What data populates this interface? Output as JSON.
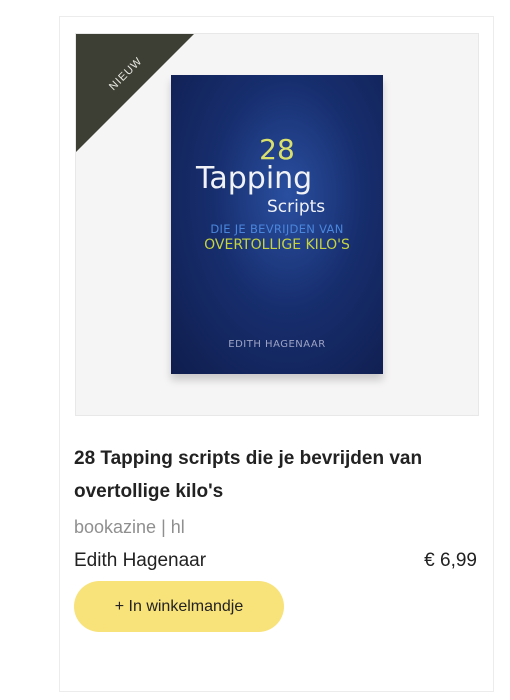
{
  "product": {
    "badge": "NIEUW",
    "cover": {
      "number": "28",
      "title": "Tapping",
      "subtitle": "Scripts",
      "tagline_1": "DIE JE BEVRIJDEN VAN",
      "tagline_2": "OVERTOLLIGE KILO'S",
      "author": "EDITH HAGENAAR"
    },
    "title": "28 Tapping scripts die je bevrijden van overtollige kilo's",
    "meta": "bookazine | hl",
    "author": "Edith Hagenaar",
    "price": "€ 6,99",
    "add_to_cart_label": "+ In winkelmandje"
  },
  "colors": {
    "badge_bg": "#3d3f35",
    "button_bg": "#f8e27a",
    "cover_bg": "#172e6e"
  }
}
